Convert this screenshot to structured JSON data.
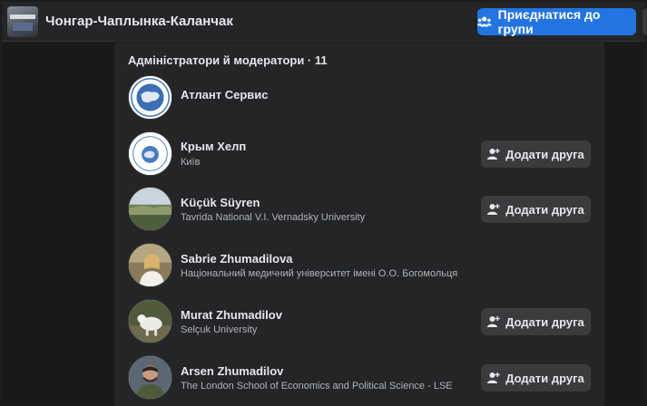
{
  "header": {
    "group_name": "Чонгар-Чаплынка-Каланчак",
    "join_label": "Приєднатися до групи"
  },
  "section": {
    "title": "Адміністратори й модератори · 11"
  },
  "members": [
    {
      "name": "Атлант Сервис",
      "subtitle": "",
      "add_label": ""
    },
    {
      "name": "Крым Хелп",
      "subtitle": "Київ",
      "add_label": "Додати друга"
    },
    {
      "name": "Küçük Süyren",
      "subtitle": "Tavrida National V.I. Vernadsky University",
      "add_label": "Додати друга"
    },
    {
      "name": "Sabrie Zhumadilova",
      "subtitle": "Національний медичний університет імені О.О. Богомольця",
      "add_label": ""
    },
    {
      "name": "Murat Zhumadilov",
      "subtitle": "Selçuk University",
      "add_label": "Додати друга"
    },
    {
      "name": "Arsen Zhumadilov",
      "subtitle": "The London School of Economics and Political Science - LSE",
      "add_label": "Додати друга"
    }
  ],
  "icons": {
    "join": "group-icon",
    "add_friend": "add-friend-icon"
  },
  "colors": {
    "accent": "#2374e1",
    "panel": "#242526",
    "button": "#3a3b3c"
  }
}
